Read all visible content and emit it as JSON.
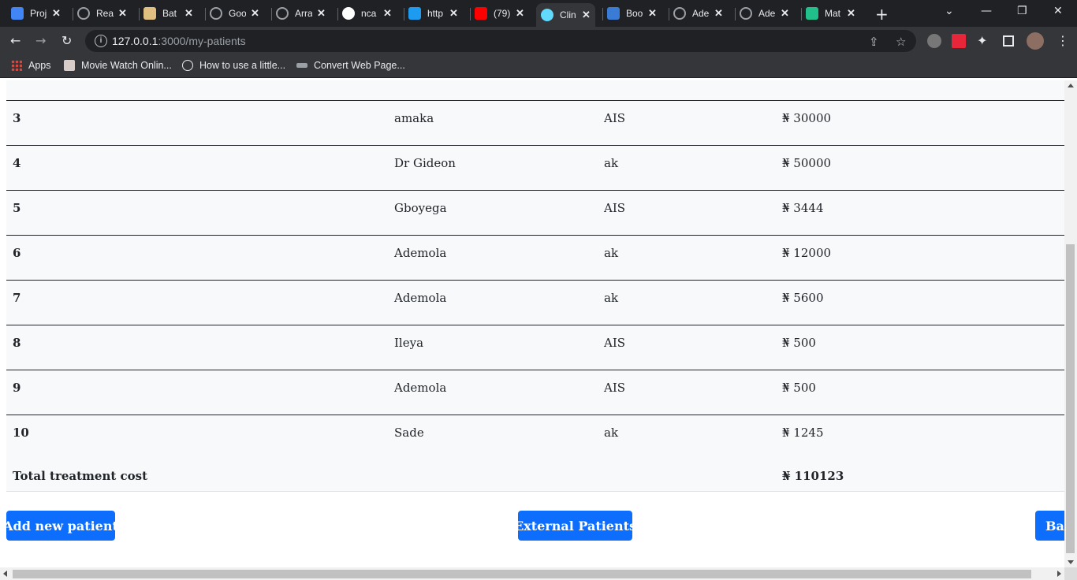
{
  "browser": {
    "tabs": [
      {
        "title": "Proj",
        "icon": "google-docs-icon",
        "color": "#4285f4"
      },
      {
        "title": "Rea",
        "icon": "globe-icon",
        "color": "#9aa0a6"
      },
      {
        "title": "Bat",
        "icon": "graduation-cap-icon",
        "color": "#e0c080"
      },
      {
        "title": "Goo",
        "icon": "globe-icon",
        "color": "#9aa0a6"
      },
      {
        "title": "Arra",
        "icon": "globe-icon",
        "color": "#9aa0a6"
      },
      {
        "title": "nca",
        "icon": "google-icon",
        "color": "#ffffff"
      },
      {
        "title": "http",
        "icon": "twitter-icon",
        "color": "#1d9bf0"
      },
      {
        "title": "(79)",
        "icon": "youtube-icon",
        "color": "#ff0000"
      },
      {
        "title": "Clin",
        "icon": "react-icon",
        "color": "#61dafb",
        "active": true
      },
      {
        "title": "Boo",
        "icon": "checkmark-icon",
        "color": "#3a7bd5"
      },
      {
        "title": "Ade",
        "icon": "globe-icon",
        "color": "#9aa0a6"
      },
      {
        "title": "Ade",
        "icon": "globe-icon",
        "color": "#9aa0a6"
      },
      {
        "title": "Mat",
        "icon": "chart-icon",
        "color": "#21c08b"
      }
    ],
    "url_host": "127.0.0.1",
    "url_path": ":3000/my-patients",
    "bookmarks": [
      {
        "label": "Apps",
        "icon": "apps-grid-icon"
      },
      {
        "label": "Movie Watch Onlin...",
        "icon": "movie-icon"
      },
      {
        "label": "How to use a little...",
        "icon": "angular-icon"
      },
      {
        "label": "Convert Web Page...",
        "icon": "web2pdf-icon"
      }
    ]
  },
  "table": {
    "currency": "₦",
    "rows": [
      {
        "num": "3",
        "name": "amaka",
        "hmo": "AIS",
        "cost": "₦ 30000"
      },
      {
        "num": "4",
        "name": "Dr Gideon",
        "hmo": "ak",
        "cost": "₦ 50000"
      },
      {
        "num": "5",
        "name": "Gboyega",
        "hmo": "AIS",
        "cost": "₦ 3444"
      },
      {
        "num": "6",
        "name": "Ademola",
        "hmo": "ak",
        "cost": "₦ 12000"
      },
      {
        "num": "7",
        "name": "Ademola",
        "hmo": "ak",
        "cost": "₦ 5600"
      },
      {
        "num": "8",
        "name": "Ileya",
        "hmo": "AIS",
        "cost": "₦ 500"
      },
      {
        "num": "9",
        "name": "Ademola",
        "hmo": "AIS",
        "cost": "₦ 500"
      },
      {
        "num": "10",
        "name": "Sade",
        "hmo": "ak",
        "cost": "₦ 1245"
      }
    ],
    "total_label": "Total treatment cost",
    "total_value": "₦ 110123"
  },
  "actions": {
    "add_label": "Add new patient",
    "external_label": "External Patients",
    "back_label": "Back"
  },
  "colors": {
    "primary": "#0d6efd",
    "row_bg": "#f8f9fa",
    "text": "#212529"
  }
}
